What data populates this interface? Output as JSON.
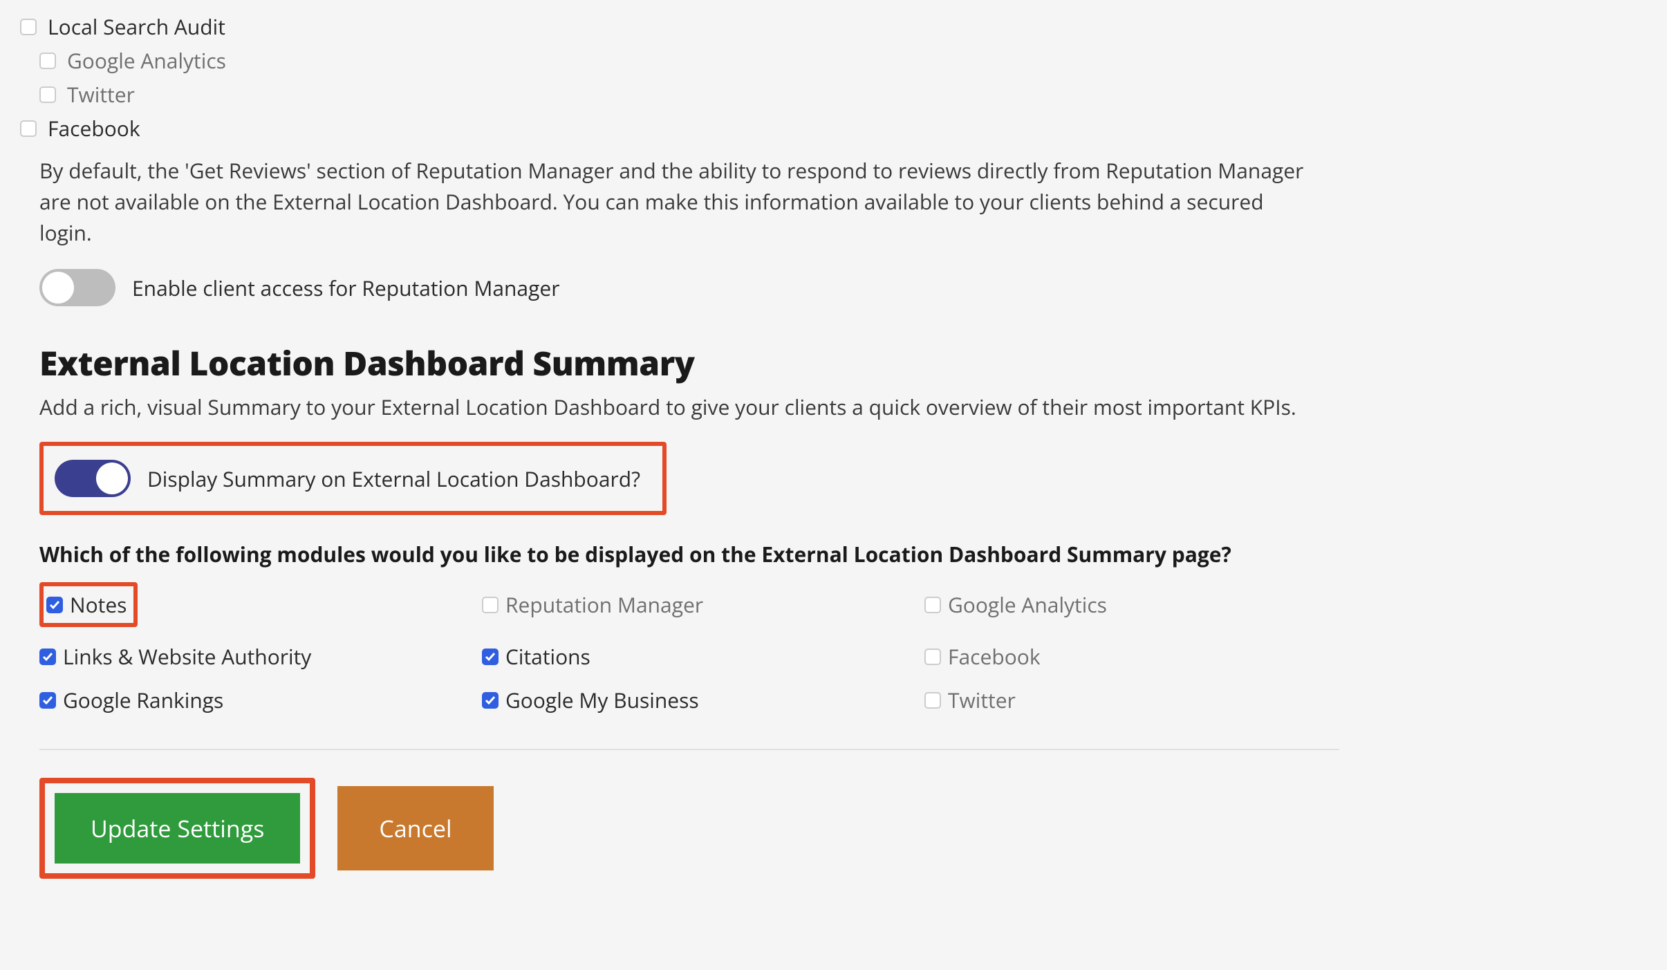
{
  "top_checkboxes": {
    "local_search_audit": {
      "label": "Local Search Audit",
      "checked": false,
      "muted": false,
      "indent": false
    },
    "google_analytics": {
      "label": "Google Analytics",
      "checked": false,
      "muted": true,
      "indent": true
    },
    "twitter": {
      "label": "Twitter",
      "checked": false,
      "muted": true,
      "indent": true
    },
    "facebook": {
      "label": "Facebook",
      "checked": false,
      "muted": false,
      "indent": false
    }
  },
  "info_paragraph": "By default, the 'Get Reviews' section of Reputation Manager and the ability to respond to reviews directly from Reputation Manager are not available on the External Location Dashboard. You can make this information available to your clients behind a secured login.",
  "enable_client_access": {
    "on": false,
    "label": "Enable client access for Reputation Manager"
  },
  "summary_section": {
    "title": "External Location Dashboard Summary",
    "description": "Add a rich, visual Summary to your External Location Dashboard to give your clients a quick overview of their most important KPIs.",
    "display_toggle": {
      "on": true,
      "label": "Display Summary on External Location Dashboard?"
    },
    "modules_question": "Which of the following modules would you like to be displayed on the External Location Dashboard Summary page?",
    "modules": {
      "notes": {
        "label": "Notes",
        "checked": true,
        "muted": false,
        "highlight": true
      },
      "reputation_manager": {
        "label": "Reputation Manager",
        "checked": false,
        "muted": true,
        "highlight": false
      },
      "google_analytics": {
        "label": "Google Analytics",
        "checked": false,
        "muted": true,
        "highlight": false
      },
      "links_authority": {
        "label": "Links & Website Authority",
        "checked": true,
        "muted": false,
        "highlight": false
      },
      "citations": {
        "label": "Citations",
        "checked": true,
        "muted": false,
        "highlight": false
      },
      "facebook": {
        "label": "Facebook",
        "checked": false,
        "muted": true,
        "highlight": false
      },
      "google_rankings": {
        "label": "Google Rankings",
        "checked": true,
        "muted": false,
        "highlight": false
      },
      "google_my_business": {
        "label": "Google My Business",
        "checked": true,
        "muted": false,
        "highlight": false
      },
      "twitter": {
        "label": "Twitter",
        "checked": false,
        "muted": true,
        "highlight": false
      }
    }
  },
  "actions": {
    "update_label": "Update Settings",
    "cancel_label": "Cancel"
  }
}
